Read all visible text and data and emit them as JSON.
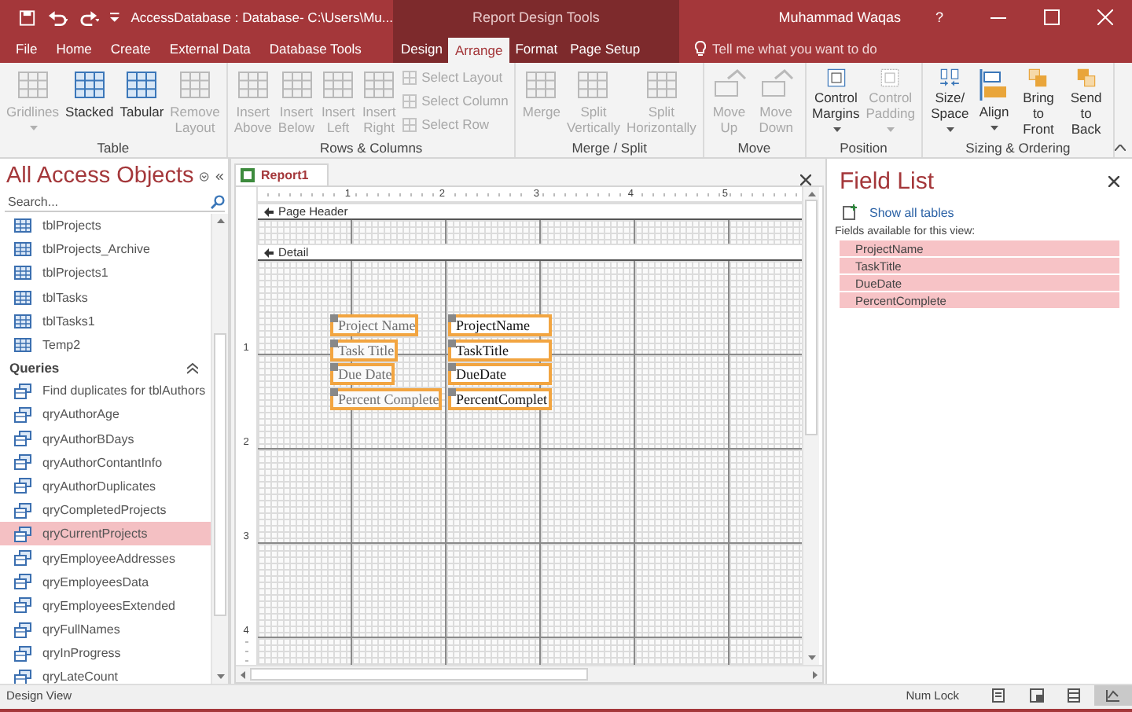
{
  "title_bar": {
    "title": "AccessDatabase : Database- C:\\Users\\Mu...",
    "context_title": "Report Design Tools",
    "user": "Muhammad Waqas",
    "help": "?"
  },
  "ribbon_tabs": [
    {
      "label": "File",
      "selected": false,
      "contextual": false
    },
    {
      "label": "Home",
      "selected": false,
      "contextual": false
    },
    {
      "label": "Create",
      "selected": false,
      "contextual": false
    },
    {
      "label": "External Data",
      "selected": false,
      "contextual": false
    },
    {
      "label": "Database Tools",
      "selected": false,
      "contextual": false
    },
    {
      "label": "Design",
      "selected": false,
      "contextual": true
    },
    {
      "label": "Arrange",
      "selected": true,
      "contextual": true
    },
    {
      "label": "Format",
      "selected": false,
      "contextual": true
    },
    {
      "label": "Page Setup",
      "selected": false,
      "contextual": true
    }
  ],
  "tell_me": {
    "placeholder": "Tell me what you want to do"
  },
  "ribbon_groups": [
    {
      "label": "Table",
      "buttons": [
        {
          "kind": "large",
          "label": "Gridlines",
          "disabled": true,
          "dropdown": true
        },
        {
          "kind": "large",
          "label": "Stacked",
          "disabled": false,
          "dropdown": false
        },
        {
          "kind": "large",
          "label": "Tabular",
          "disabled": false,
          "dropdown": false
        },
        {
          "kind": "large",
          "label": "Remove Layout",
          "disabled": true,
          "dropdown": false
        }
      ]
    },
    {
      "label": "Rows & Columns",
      "buttons": [
        {
          "kind": "large",
          "label": "Insert Above",
          "disabled": true,
          "dropdown": false
        },
        {
          "kind": "large",
          "label": "Insert Below",
          "disabled": true,
          "dropdown": false
        },
        {
          "kind": "large",
          "label": "Insert Left",
          "disabled": true,
          "dropdown": false
        },
        {
          "kind": "large",
          "label": "Insert Right",
          "disabled": true,
          "dropdown": false
        },
        {
          "kind": "small",
          "label": "Select Layout",
          "disabled": true,
          "dropdown": false
        },
        {
          "kind": "small",
          "label": "Select Column",
          "disabled": true,
          "dropdown": false
        },
        {
          "kind": "small",
          "label": "Select Row",
          "disabled": true,
          "dropdown": false
        }
      ]
    },
    {
      "label": "Merge / Split",
      "buttons": [
        {
          "kind": "large",
          "label": "Merge",
          "disabled": true,
          "dropdown": false
        },
        {
          "kind": "large",
          "label": "Split Vertically",
          "disabled": true,
          "dropdown": false
        },
        {
          "kind": "large",
          "label": "Split Horizontally",
          "disabled": true,
          "dropdown": false
        }
      ]
    },
    {
      "label": "Move",
      "buttons": [
        {
          "kind": "large",
          "label": "Move Up",
          "disabled": true,
          "dropdown": false
        },
        {
          "kind": "large",
          "label": "Move Down",
          "disabled": true,
          "dropdown": false
        }
      ]
    },
    {
      "label": "Position",
      "buttons": [
        {
          "kind": "large",
          "label": "Control Margins",
          "disabled": false,
          "dropdown": true
        },
        {
          "kind": "large",
          "label": "Control Padding",
          "disabled": true,
          "dropdown": true
        }
      ]
    },
    {
      "label": "Sizing & Ordering",
      "buttons": [
        {
          "kind": "large",
          "label": "Size/ Space",
          "disabled": false,
          "dropdown": true
        },
        {
          "kind": "large",
          "label": "Align",
          "disabled": false,
          "dropdown": true
        },
        {
          "kind": "large",
          "label": "Bring to Front",
          "disabled": false,
          "dropdown": false
        },
        {
          "kind": "large",
          "label": "Send to Back",
          "disabled": false,
          "dropdown": false
        }
      ]
    }
  ],
  "navigation": {
    "title": "All Access Objects",
    "search": {
      "placeholder": "Search..."
    },
    "groups": [
      {
        "items": [
          {
            "kind": "table",
            "label": "tblProjects",
            "selected": false
          },
          {
            "kind": "table",
            "label": "tblProjects_Archive",
            "selected": false
          },
          {
            "kind": "table",
            "label": "tblProjects1",
            "selected": false
          },
          {
            "kind": "table",
            "label": "tblTasks",
            "selected": false
          },
          {
            "kind": "table",
            "label": "tblTasks1",
            "selected": false
          },
          {
            "kind": "table",
            "label": "Temp2",
            "selected": false
          }
        ]
      },
      {
        "label": "Queries",
        "expanded": true,
        "items": [
          {
            "kind": "query",
            "label": "Find duplicates for tblAuthors",
            "selected": false
          },
          {
            "kind": "query",
            "label": "qryAuthorAge",
            "selected": false
          },
          {
            "kind": "query",
            "label": "qryAuthorBDays",
            "selected": false
          },
          {
            "kind": "query",
            "label": "qryAuthorContantInfo",
            "selected": false
          },
          {
            "kind": "query",
            "label": "qryAuthorDuplicates",
            "selected": false
          },
          {
            "kind": "query",
            "label": "qryCompletedProjects",
            "selected": false
          },
          {
            "kind": "query",
            "label": "qryCurrentProjects",
            "selected": true
          },
          {
            "kind": "query",
            "label": "qryEmployeeAddresses",
            "selected": false
          },
          {
            "kind": "query",
            "label": "qryEmployeesData",
            "selected": false
          },
          {
            "kind": "query",
            "label": "qryEmployeesExtended",
            "selected": false
          },
          {
            "kind": "query",
            "label": "qryFullNames",
            "selected": false
          },
          {
            "kind": "query",
            "label": "qryInProgress",
            "selected": false
          },
          {
            "kind": "query",
            "label": "qryLateCount",
            "selected": false
          }
        ]
      }
    ]
  },
  "document": {
    "tab": "Report1",
    "ruler": [
      "1",
      "2",
      "3",
      "4",
      "5"
    ],
    "vertical_ruler": [
      "1",
      "2",
      "3",
      "4"
    ],
    "sections": [
      "Page Header",
      "Detail"
    ],
    "controls": [
      {
        "label": "Project Name",
        "field": "ProjectName",
        "selected": true
      },
      {
        "label": "Task Title",
        "field": "TaskTitle",
        "selected": true
      },
      {
        "label": "Due Date",
        "field": "DueDate",
        "selected": true
      },
      {
        "label": "Percent Complete",
        "field": "PercentComplet",
        "selected": true
      }
    ]
  },
  "field_list": {
    "title": "Field List",
    "link": "Show all tables",
    "caption": "Fields available for this view:",
    "fields": [
      {
        "name": "ProjectName",
        "selected": true
      },
      {
        "name": "TaskTitle",
        "selected": true
      },
      {
        "name": "DueDate",
        "selected": true
      },
      {
        "name": "PercentComplete",
        "selected": true
      }
    ]
  },
  "status_bar": {
    "left": "Design View",
    "right": "Num Lock",
    "views": [
      {
        "selected": false
      },
      {
        "selected": false
      },
      {
        "selected": false
      },
      {
        "selected": true
      }
    ]
  }
}
